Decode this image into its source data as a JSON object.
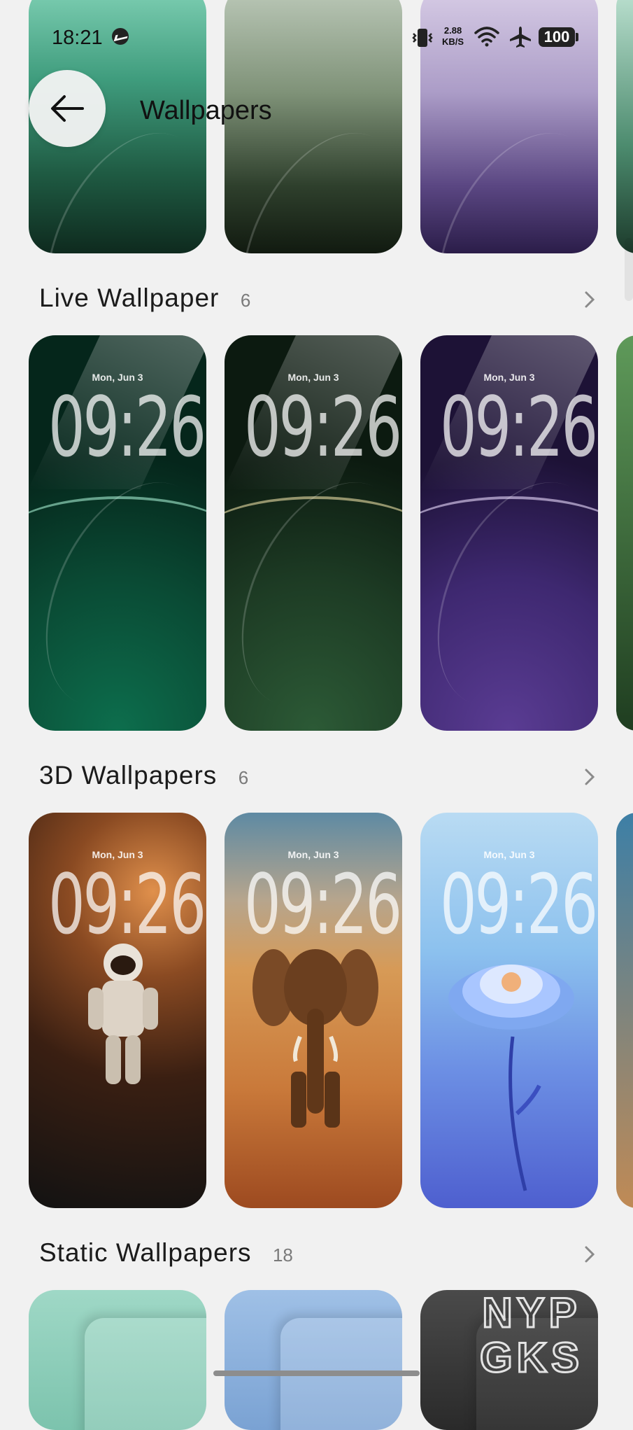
{
  "status_bar": {
    "time": "18:21",
    "net_speed_value": "2.88",
    "net_speed_unit": "KB/S",
    "battery": "100",
    "icons": [
      "messenger-icon",
      "vibrate-icon",
      "wifi-icon",
      "airplane-icon",
      "battery-icon"
    ]
  },
  "header": {
    "title": "Wallpapers",
    "back_icon": "arrow-left-icon"
  },
  "lock_preview": {
    "date": "Mon, Jun 3",
    "time": "09:26"
  },
  "sections": [
    {
      "title": "Live Wallpaper",
      "count": "6"
    },
    {
      "title": "3D Wallpapers",
      "count": "6"
    },
    {
      "title": "Static Wallpapers",
      "count": "18"
    }
  ],
  "watermark": {
    "line1": "NYP",
    "line2": "GKS"
  },
  "colors": {
    "background": "#f1f1f1",
    "text_primary": "#1b1b1b",
    "text_secondary": "#7a7a7a"
  }
}
